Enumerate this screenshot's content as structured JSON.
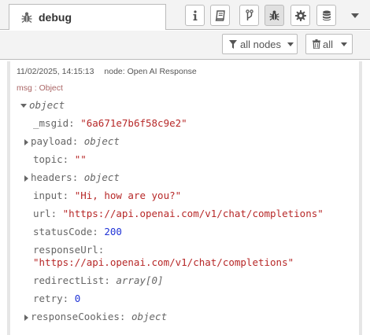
{
  "tab": {
    "icon": "bug-icon",
    "label": "debug"
  },
  "toolbar_icons": [
    "info-icon",
    "book-icon",
    "branch-icon",
    "bug-icon",
    "gear-icon",
    "database-icon"
  ],
  "more_icon": "caret-down-icon",
  "filters": {
    "nodes_label": "all nodes",
    "clear_label": "all"
  },
  "message": {
    "timestamp": "11/02/2025, 14:15:13",
    "node": "node: Open AI Response",
    "topic_line": "msg : Object",
    "root_label": "object",
    "props": [
      {
        "key": "_msgid",
        "sep": ": ",
        "value": "\"6a671e7b6f58c9e2\"",
        "kind": "str",
        "expandable": false
      },
      {
        "key": "payload",
        "sep": ": ",
        "value": "object",
        "kind": "typ",
        "expandable": true
      },
      {
        "key": "topic",
        "sep": ": ",
        "value": "\"\"",
        "kind": "str",
        "expandable": false
      },
      {
        "key": "headers",
        "sep": ": ",
        "value": "object",
        "kind": "typ",
        "expandable": true
      },
      {
        "key": "input",
        "sep": ": ",
        "value": "\"Hi, how are you?\"",
        "kind": "str",
        "expandable": false
      },
      {
        "key": "url",
        "sep": ": ",
        "value": "\"https://api.openai.com/v1/chat/completions\"",
        "kind": "str",
        "expandable": false
      },
      {
        "key": "statusCode",
        "sep": ": ",
        "value": "200",
        "kind": "num",
        "expandable": false
      },
      {
        "key": "responseUrl",
        "sep": ":",
        "value": "\"https://api.openai.com/v1/chat/completions\"",
        "kind": "str",
        "expandable": false,
        "wrapped": true
      },
      {
        "key": "redirectList",
        "sep": ": ",
        "value": "array[0]",
        "kind": "typ",
        "expandable": false
      },
      {
        "key": "retry",
        "sep": ": ",
        "value": "0",
        "kind": "num",
        "expandable": false
      },
      {
        "key": "responseCookies",
        "sep": ": ",
        "value": "object",
        "kind": "typ",
        "expandable": true
      }
    ]
  },
  "colors": {
    "string": "#b72828",
    "number": "#2033d6",
    "topic": "#aa6666",
    "panel_bg": "#f3f3f3",
    "border": "#bbbbbb"
  }
}
